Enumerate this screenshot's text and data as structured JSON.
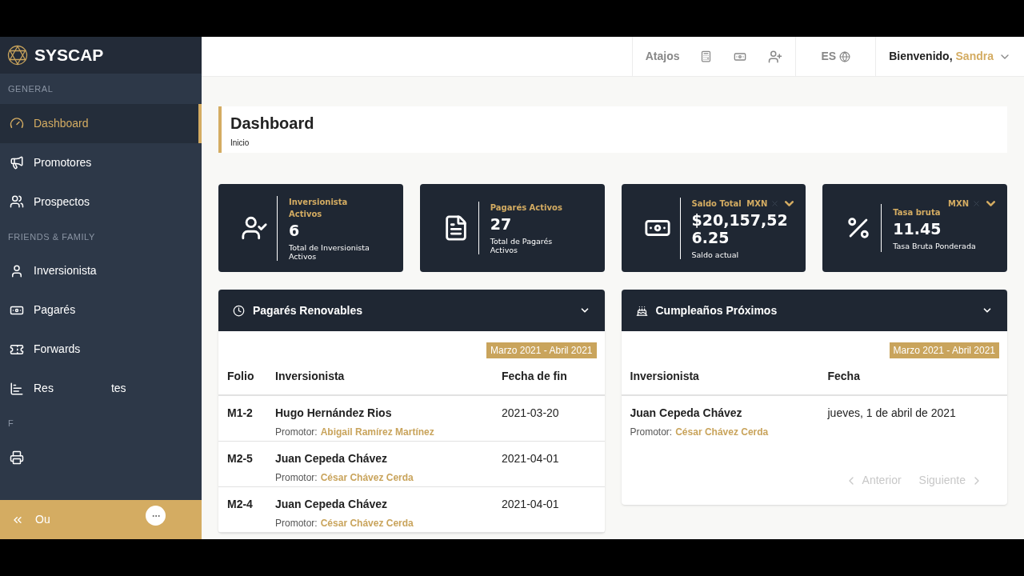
{
  "brand": "SYSCAP",
  "sidebar": {
    "sections": [
      {
        "heading": "GENERAL",
        "items": [
          {
            "kind": "gauge",
            "label": "Dashboard",
            "selected": true
          },
          {
            "kind": "megaphone",
            "label": "Promotores",
            "selected": false
          },
          {
            "kind": "users",
            "label": "Prospectos",
            "selected": false
          }
        ]
      },
      {
        "heading": "FRIENDS & FAMILY",
        "items": [
          {
            "kind": "user",
            "label": "Inversionista",
            "selected": false
          },
          {
            "kind": "banknote",
            "label": "Pagarés",
            "selected": false
          },
          {
            "kind": "ticket",
            "label": "Forwards",
            "selected": false
          },
          {
            "kind": "chart",
            "label": "Res",
            "label_end": "tes",
            "selected": false
          }
        ]
      },
      {
        "heading": "F",
        "items": [
          {
            "kind": "printer",
            "selected": false
          }
        ]
      }
    ],
    "collapse": {
      "label": "Ou"
    }
  },
  "topbar": {
    "shortcuts_label": "Atajos",
    "language": "ES",
    "greeting": "Bienvenido,",
    "user": "Sandra"
  },
  "page": {
    "title": "Dashboard",
    "breadcrumb": "Inicio"
  },
  "stats": [
    {
      "kind": "user-check",
      "title": "Inversionista Activos",
      "value": "6",
      "caption": "Total de Inversionista Activos"
    },
    {
      "kind": "file",
      "title": "Pagarés Activos",
      "value": "27",
      "caption": "Total de Pagarés Activos"
    },
    {
      "kind": "banknote",
      "title": "Saldo Total",
      "currency": "MXN",
      "value": "$20,157,526.25",
      "caption": "Saldo actual"
    },
    {
      "kind": "percent",
      "title": "Tasa bruta",
      "currency": "MXN",
      "value": "11.45",
      "caption": "Tasa Bruta Ponderada"
    }
  ],
  "renewable": {
    "title": "Pagarés Renovables",
    "period": "Marzo 2021 - Abril 2021",
    "columns": [
      "Folio",
      "Inversionista",
      "Fecha de fin"
    ],
    "rows": [
      {
        "folio": "M1-2",
        "investor": "Hugo Hernández Rios",
        "promoter_label": "Promotor:",
        "promoter": "Abigail Ramírez Martínez",
        "end_date": "2021-03-20"
      },
      {
        "folio": "M2-5",
        "investor": "Juan Cepeda Chávez",
        "promoter_label": "Promotor:",
        "promoter": "César Chávez Cerda",
        "end_date": "2021-04-01"
      },
      {
        "folio": "M2-4",
        "investor": "Juan Cepeda Chávez",
        "promoter_label": "Promotor:",
        "promoter": "César Chávez Cerda",
        "end_date": "2021-04-01"
      }
    ]
  },
  "birthdays": {
    "title": "Cumpleaños Próximos",
    "period": "Marzo 2021 - Abril 2021",
    "columns": [
      "Inversionista",
      "Fecha"
    ],
    "rows": [
      {
        "investor": "Juan Cepeda Chávez",
        "promoter_label": "Promotor:",
        "promoter": "César Chávez Cerda",
        "date": "jueves, 1 de abril de 2021"
      }
    ],
    "prev": "Anterior",
    "next": "Siguiente"
  }
}
